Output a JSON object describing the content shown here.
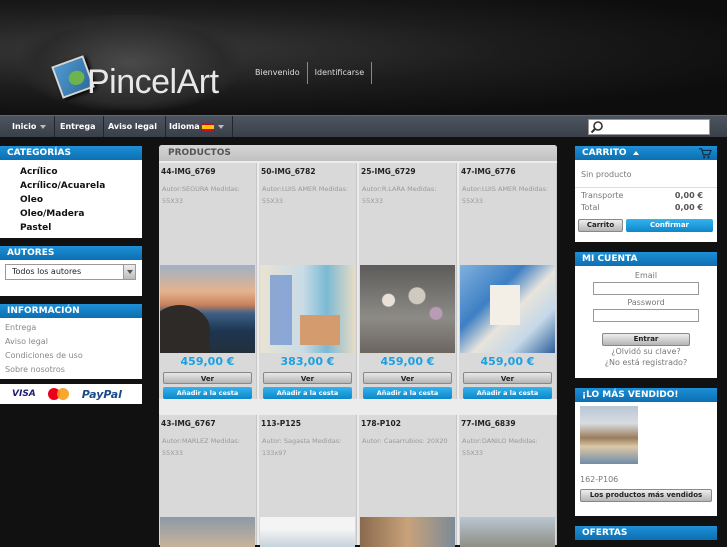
{
  "brand": {
    "name": "PincelArt"
  },
  "user_links": [
    "Bienvenido",
    "Identificarse"
  ],
  "nav": {
    "items": [
      "Inicio",
      "Entrega",
      "Aviso legal",
      "Idioma"
    ],
    "search_placeholder": ""
  },
  "left": {
    "categories_title": "CATEGORÍAS",
    "categories": [
      "Acrílico",
      "Acrílico/Acuarela",
      "Oleo",
      "Oleo/Madera",
      "Pastel"
    ],
    "authors_title": "AUTORES",
    "authors_selected": "Todos los autores",
    "info_title": "INFORMACIÓN",
    "info_links": [
      "Entrega",
      "Aviso legal",
      "Condiciones de uso",
      "Sobre nosotros"
    ],
    "payment": [
      "VISA",
      "MasterCard",
      "PayPal"
    ]
  },
  "center": {
    "title": "PRODUCTOS",
    "view_label": "Ver",
    "add_label": "Añadir a la cesta",
    "products": [
      {
        "title": "44-IMG_6769",
        "desc": "Autor:SEGURA Medidas: 55X33",
        "price": "459,00 €"
      },
      {
        "title": "50-IMG_6782",
        "desc": "Autor:LUIS AMER Medidas: 55X33",
        "price": "383,00 €"
      },
      {
        "title": "25-IMG_6729",
        "desc": "Autor:R.LARA Medidas: 55X33",
        "price": "459,00 €"
      },
      {
        "title": "47-IMG_6776",
        "desc": "Autor:LUIS AMER Medidas: 55X33",
        "price": "459,00 €"
      },
      {
        "title": "43-IMG_6767",
        "desc": "Autor:MARLEZ Medidas: 55X33",
        "price": ""
      },
      {
        "title": "113-P125",
        "desc": "Autor: Sagasta Medidas: 133x97",
        "price": ""
      },
      {
        "title": "178-P102",
        "desc": "Autor: Casarrubios: 20X20",
        "price": ""
      },
      {
        "title": "77-IMG_6839",
        "desc": "Autor:DANILO Medidas: 55X33",
        "price": ""
      }
    ]
  },
  "right": {
    "cart_title": "CARRITO",
    "cart_empty": "Sin producto",
    "shipping_label": "Transporte",
    "shipping_value": "0,00 €",
    "total_label": "Total",
    "total_value": "0,00 €",
    "cart_button": "Carrito",
    "confirm_button": "Confirmar",
    "account_title": "MI CUENTA",
    "email_label": "Email",
    "password_label": "Password",
    "login_button": "Entrar",
    "forgot_link": "¿Olvidó su clave?",
    "register_link": "¿No está registrado?",
    "bestsellers_title": "¡LO MÁS VENDIDO!",
    "bestseller_name": "162-P106",
    "bestsellers_button": "Los productos más vendidos",
    "offers_title": "OFERTAS"
  }
}
